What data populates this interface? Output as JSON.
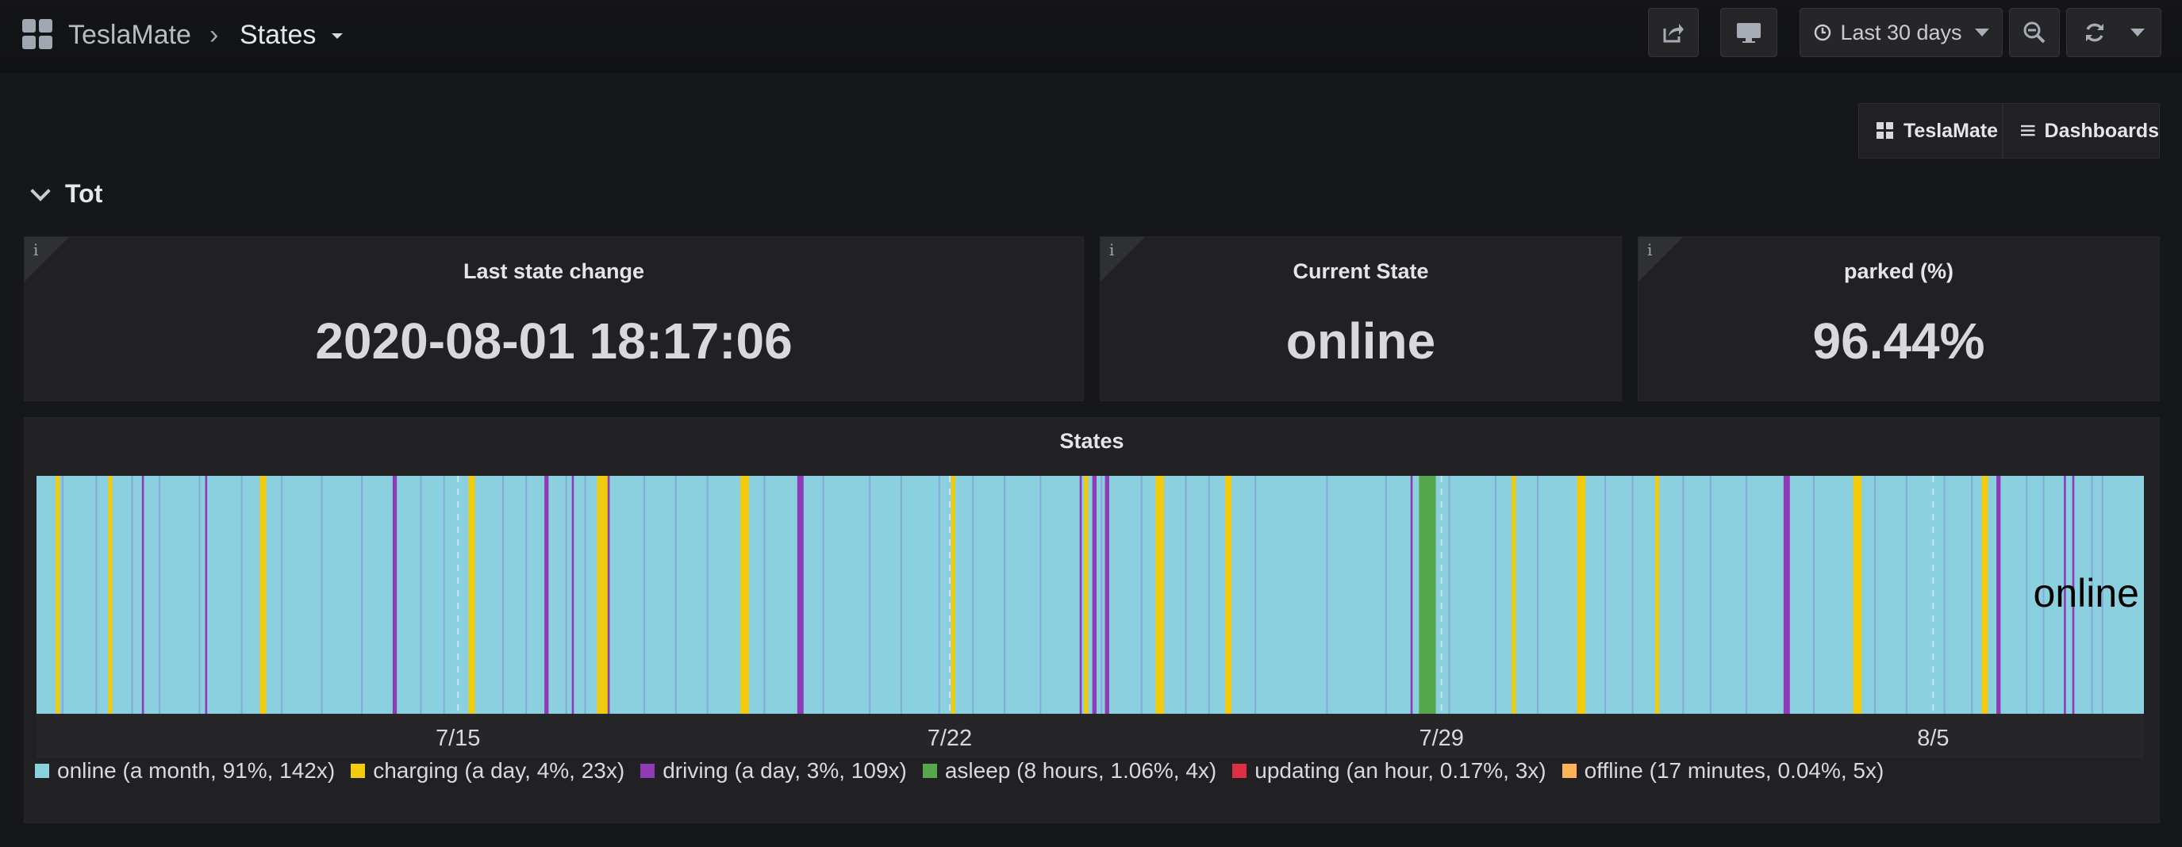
{
  "header": {
    "app_name": "TeslaMate",
    "separator": "›",
    "page_title": "States",
    "time_range": "Last 30 days"
  },
  "nav": {
    "teslamate_label": "TeslaMate",
    "dashboards_label": "Dashboards"
  },
  "row": {
    "title": "Tot"
  },
  "panels": {
    "last_change": {
      "title": "Last state change",
      "value": "2020-08-01 18:17:06"
    },
    "current_state": {
      "title": "Current State",
      "value": "online"
    },
    "parked": {
      "title": "parked (%)",
      "value": "96.44%"
    }
  },
  "icons": {
    "apps": "grid-icon",
    "share": "share-icon",
    "tv": "monitor-icon",
    "clock": "clock-icon",
    "zoom": "zoom-out-icon",
    "refresh": "refresh-icon",
    "info": "info-icon"
  },
  "colors": {
    "online": "#8ad0df",
    "charging": "#f2cc0c",
    "driving": "#8f3bb8",
    "asleep": "#56a64b",
    "updating": "#e02f44",
    "offline": "#ffb357"
  },
  "chart_data": {
    "type": "timeline",
    "title": "States",
    "x_range": [
      "2020-07-09",
      "2020-08-08"
    ],
    "x_ticks": [
      "7/15",
      "7/22",
      "7/29",
      "8/5"
    ],
    "current_label": "online",
    "base_state": "online",
    "bands": [
      {
        "state": "charging",
        "start": 0.009,
        "end": 0.011
      },
      {
        "state": "charging",
        "start": 0.034,
        "end": 0.036
      },
      {
        "state": "driving",
        "start": 0.05,
        "end": 0.051
      },
      {
        "state": "driving",
        "start": 0.08,
        "end": 0.081
      },
      {
        "state": "charging",
        "start": 0.106,
        "end": 0.109
      },
      {
        "state": "driving",
        "start": 0.169,
        "end": 0.171
      },
      {
        "state": "charging",
        "start": 0.205,
        "end": 0.208
      },
      {
        "state": "driving",
        "start": 0.241,
        "end": 0.243
      },
      {
        "state": "driving",
        "start": 0.254,
        "end": 0.255
      },
      {
        "state": "charging",
        "start": 0.266,
        "end": 0.268
      },
      {
        "state": "charging",
        "start": 0.268,
        "end": 0.272
      },
      {
        "state": "driving",
        "start": 0.271,
        "end": 0.272
      },
      {
        "state": "charging",
        "start": 0.334,
        "end": 0.338
      },
      {
        "state": "driving",
        "start": 0.361,
        "end": 0.364
      },
      {
        "state": "charging",
        "start": 0.434,
        "end": 0.436
      },
      {
        "state": "driving",
        "start": 0.495,
        "end": 0.496
      },
      {
        "state": "charging",
        "start": 0.497,
        "end": 0.499
      },
      {
        "state": "driving",
        "start": 0.501,
        "end": 0.503
      },
      {
        "state": "driving",
        "start": 0.507,
        "end": 0.509
      },
      {
        "state": "charging",
        "start": 0.531,
        "end": 0.535
      },
      {
        "state": "charging",
        "start": 0.564,
        "end": 0.567
      },
      {
        "state": "driving",
        "start": 0.652,
        "end": 0.653
      },
      {
        "state": "asleep",
        "start": 0.656,
        "end": 0.664
      },
      {
        "state": "charging",
        "start": 0.7,
        "end": 0.702
      },
      {
        "state": "charging",
        "start": 0.731,
        "end": 0.735
      },
      {
        "state": "charging",
        "start": 0.768,
        "end": 0.77
      },
      {
        "state": "driving",
        "start": 0.829,
        "end": 0.832
      },
      {
        "state": "charging",
        "start": 0.862,
        "end": 0.866
      },
      {
        "state": "charging",
        "start": 0.923,
        "end": 0.926
      },
      {
        "state": "driving",
        "start": 0.93,
        "end": 0.932
      },
      {
        "state": "driving",
        "start": 0.962,
        "end": 0.963
      },
      {
        "state": "driving",
        "start": 0.966,
        "end": 0.967
      }
    ],
    "thin_lines": [
      0.012,
      0.028,
      0.045,
      0.058,
      0.077,
      0.097,
      0.116,
      0.135,
      0.154,
      0.182,
      0.193,
      0.221,
      0.232,
      0.251,
      0.26,
      0.288,
      0.303,
      0.318,
      0.345,
      0.373,
      0.395,
      0.41,
      0.428,
      0.444,
      0.459,
      0.476,
      0.505,
      0.524,
      0.545,
      0.556,
      0.578,
      0.612,
      0.64,
      0.67,
      0.692,
      0.712,
      0.744,
      0.757,
      0.781,
      0.794,
      0.811,
      0.843,
      0.872,
      0.887,
      0.905,
      0.918,
      0.944,
      0.952,
      0.975,
      0.98
    ],
    "legend": [
      {
        "state": "online",
        "label": "online (a month, 91%, 142x)"
      },
      {
        "state": "charging",
        "label": "charging (a day, 4%, 23x)"
      },
      {
        "state": "driving",
        "label": "driving (a day, 3%, 109x)"
      },
      {
        "state": "asleep",
        "label": "asleep (8 hours, 1.06%, 4x)"
      },
      {
        "state": "updating",
        "label": "updating (an hour, 0.17%, 3x)"
      },
      {
        "state": "offline",
        "label": "offline (17 minutes, 0.04%, 5x)"
      }
    ]
  }
}
